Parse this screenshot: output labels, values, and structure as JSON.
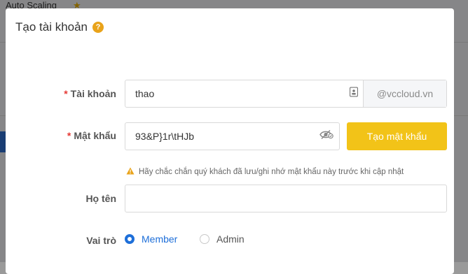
{
  "background": {
    "app_title": "Auto Scaling"
  },
  "modal": {
    "title": "Tạo tài khoản",
    "help_icon": "?"
  },
  "form": {
    "account": {
      "label": "Tài khoản",
      "required_mark": "*",
      "value": "thao",
      "suffix": "@vccloud.vn",
      "icon": "contact-card-icon"
    },
    "password": {
      "label": "Mật khẩu",
      "required_mark": "*",
      "value": "93&P}1r\\tHJb",
      "icon": "eye-hidden-icon",
      "generate_button": "Tạo mật khẩu"
    },
    "warning": {
      "icon": "warning-icon",
      "text": "Hãy chắc chắn quý khách đã lưu/ghi nhớ mật khẩu này trước khi cập nhật"
    },
    "fullname": {
      "label": "Họ tên",
      "value": ""
    },
    "role": {
      "label": "Vai trò",
      "options": [
        {
          "label": "Member",
          "selected": true
        },
        {
          "label": "Admin",
          "selected": false
        }
      ]
    }
  },
  "colors": {
    "accent": "#1e6fd9",
    "primary_button": "#f2c318",
    "required": "#e53935",
    "help": "#e9a31a"
  }
}
